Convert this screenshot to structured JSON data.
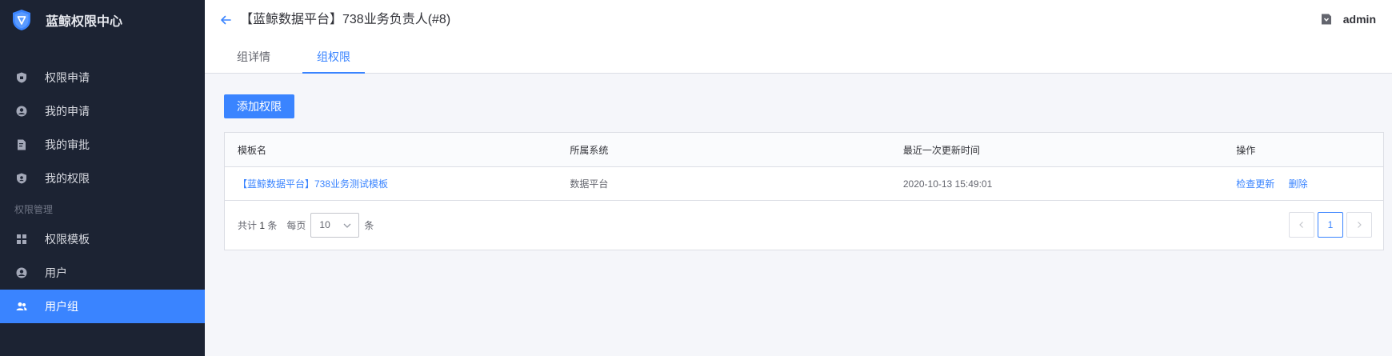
{
  "app": {
    "title": "蓝鲸权限中心"
  },
  "sidebar": {
    "items": [
      {
        "label": "权限申请"
      },
      {
        "label": "我的申请"
      },
      {
        "label": "我的审批"
      },
      {
        "label": "我的权限"
      }
    ],
    "group_label": "权限管理",
    "manage_items": [
      {
        "label": "权限模板"
      },
      {
        "label": "用户"
      },
      {
        "label": "用户组"
      }
    ]
  },
  "header": {
    "title": "【蓝鲸数据平台】738业务负责人(#8)",
    "user": "admin"
  },
  "tabs": [
    {
      "label": "组详情"
    },
    {
      "label": "组权限"
    }
  ],
  "actions": {
    "add_permission": "添加权限"
  },
  "table": {
    "columns": [
      "模板名",
      "所属系统",
      "最近一次更新时间",
      "操作"
    ],
    "rows": [
      {
        "template": "【蓝鲸数据平台】738业务测试模板",
        "system": "数据平台",
        "updated": "2020-10-13 15:49:01",
        "op_check": "检查更新",
        "op_delete": "删除"
      }
    ]
  },
  "pagination": {
    "total_prefix": "共计",
    "total": "1",
    "total_suffix": "条",
    "per_page_label": "每页",
    "per_page_value": "10",
    "per_page_suffix": "条",
    "current_page": "1"
  },
  "colors": {
    "accent": "#3a84ff",
    "sidebar_bg": "#1c2333"
  }
}
